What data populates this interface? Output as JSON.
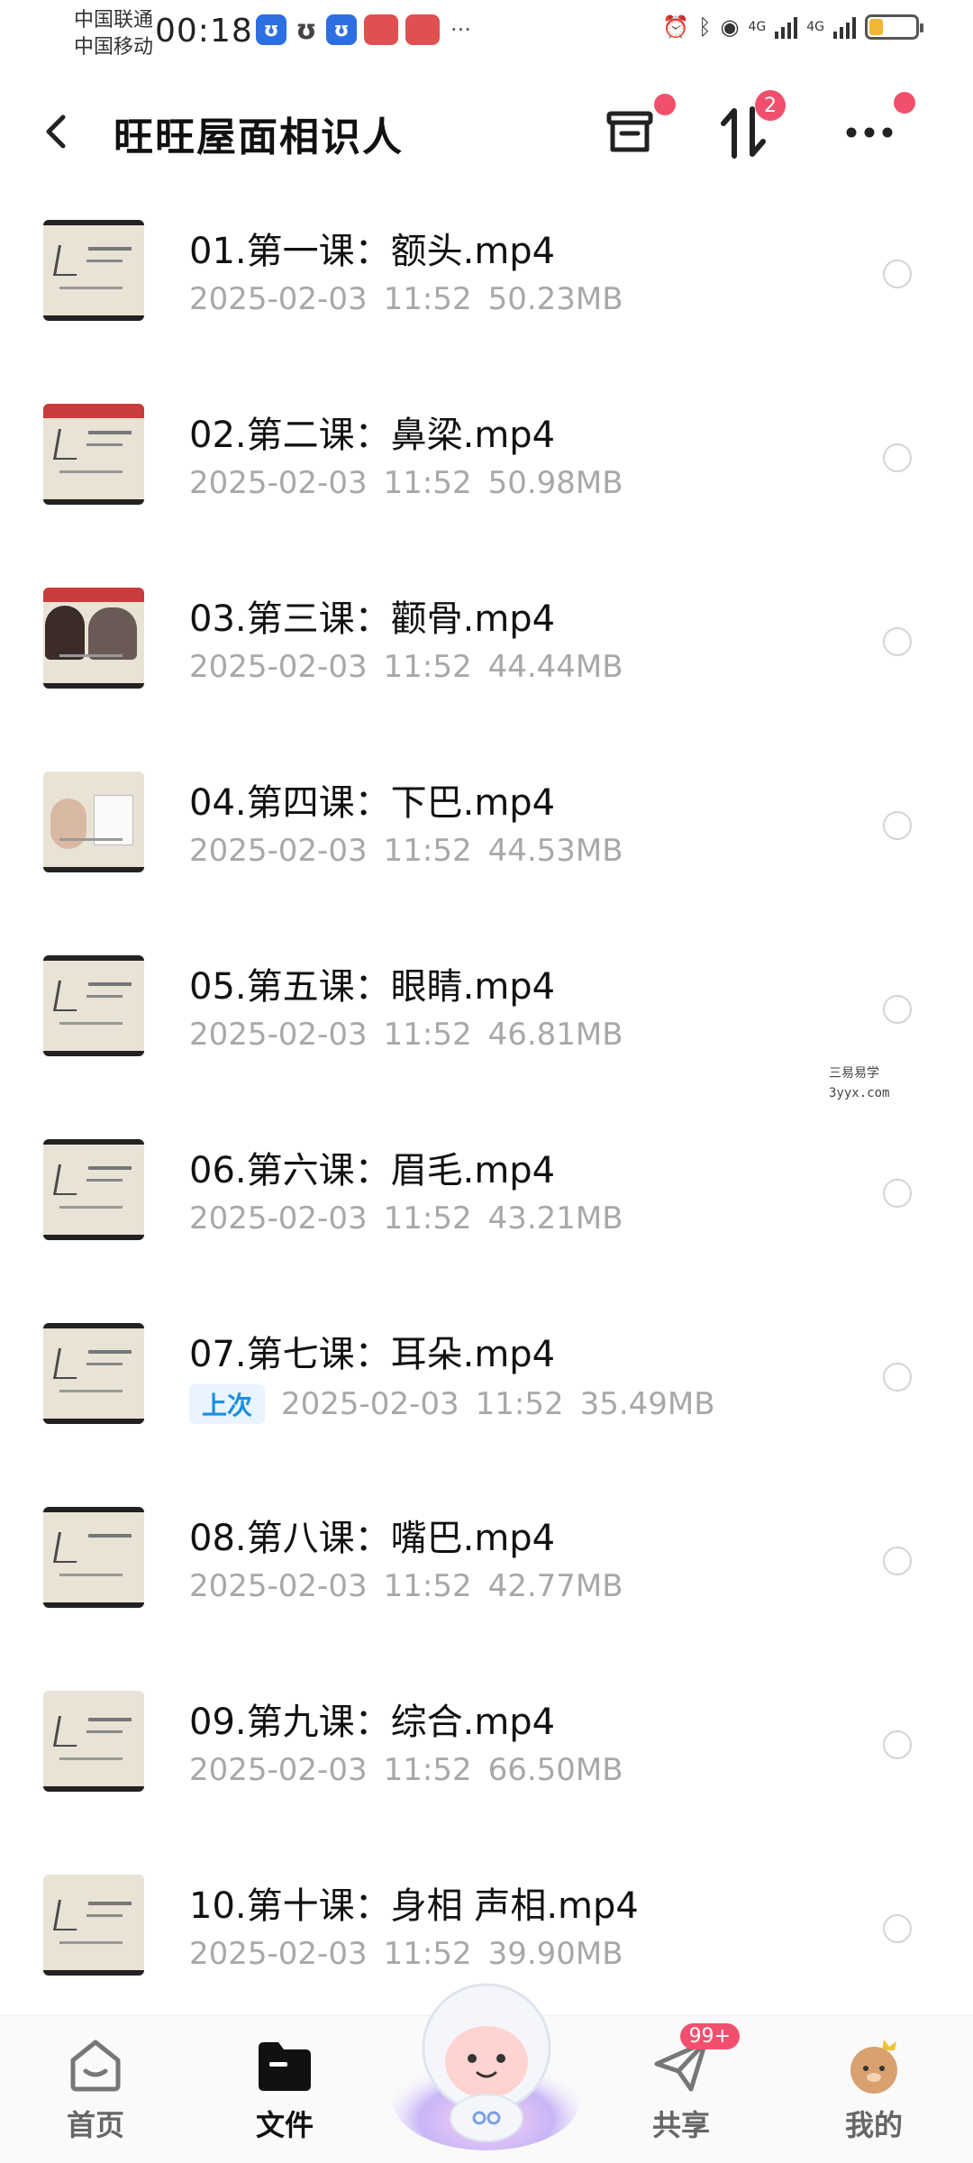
{
  "status_bar": {
    "carrier_1": "中国联通",
    "carrier_2": "中国移动",
    "time": "00:18",
    "network_1": "4G",
    "network_2": "4G",
    "battery_level": 0.3,
    "battery_color": "#f2b632"
  },
  "header": {
    "title": "旺旺屋面相识人",
    "transfer_badge": "2",
    "accent": "#f0506e"
  },
  "files": [
    {
      "name": "01.第一课：额头.mp4",
      "date": "2025-02-03",
      "time": "11:52",
      "size": "50.23MB"
    },
    {
      "name": "02.第二课：鼻梁.mp4",
      "date": "2025-02-03",
      "time": "11:52",
      "size": "50.98MB"
    },
    {
      "name": "03.第三课：颧骨.mp4",
      "date": "2025-02-03",
      "time": "11:52",
      "size": "44.44MB"
    },
    {
      "name": "04.第四课：下巴.mp4",
      "date": "2025-02-03",
      "time": "11:52",
      "size": "44.53MB"
    },
    {
      "name": "05.第五课：眼睛.mp4",
      "date": "2025-02-03",
      "time": "11:52",
      "size": "46.81MB"
    },
    {
      "name": "06.第六课：眉毛.mp4",
      "date": "2025-02-03",
      "time": "11:52",
      "size": "43.21MB"
    },
    {
      "name": "07.第七课：耳朵.mp4",
      "tag": "上次",
      "date": "2025-02-03",
      "time": "11:52",
      "size": "35.49MB"
    },
    {
      "name": "08.第八课：嘴巴.mp4",
      "date": "2025-02-03",
      "time": "11:52",
      "size": "42.77MB"
    },
    {
      "name": "09.第九课：综合.mp4",
      "date": "2025-02-03",
      "time": "11:52",
      "size": "66.50MB"
    },
    {
      "name": "10.第十课：身相 声相.mp4",
      "date": "2025-02-03",
      "time": "11:52",
      "size": "39.90MB"
    }
  ],
  "watermark": {
    "line_1": "三易易学",
    "line_2": "3yyx.com"
  },
  "bottom_nav": {
    "home": "首页",
    "files": "文件",
    "share": "共享",
    "share_badge": "99+",
    "mine": "我的"
  }
}
